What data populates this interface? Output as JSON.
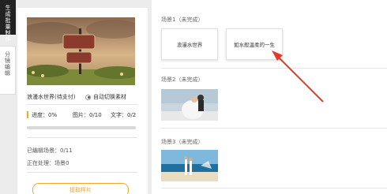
{
  "sidebar": {
    "tab_active": [
      "生",
      "成",
      "批",
      "量",
      "制",
      "作"
    ],
    "tab_inactive": [
      "分",
      "镜",
      "编",
      "辑"
    ]
  },
  "left_panel": {
    "scene_name": "浪漫水世界(待支付)",
    "auto_switch_label": "自动切换素材",
    "progress_label": "进度：0%",
    "images_label": "图片：0/10",
    "text_label": "文字：0/2",
    "progress_value": 0,
    "edited_label": "已编辑场景：0/11",
    "processing_label": "正在处理：场景0",
    "generate_button": "提取样片"
  },
  "main": {
    "scenes": [
      {
        "title": "场景1（未完成）",
        "cards": [
          "浪漫水世界",
          "如水般温柔的一生"
        ]
      },
      {
        "title": "场景2（未完成）"
      },
      {
        "title": "场景3（未完成）"
      }
    ]
  },
  "colors": {
    "accent": "#f5a623",
    "arrow": "#e8382e",
    "dark_tab": "#222222"
  }
}
